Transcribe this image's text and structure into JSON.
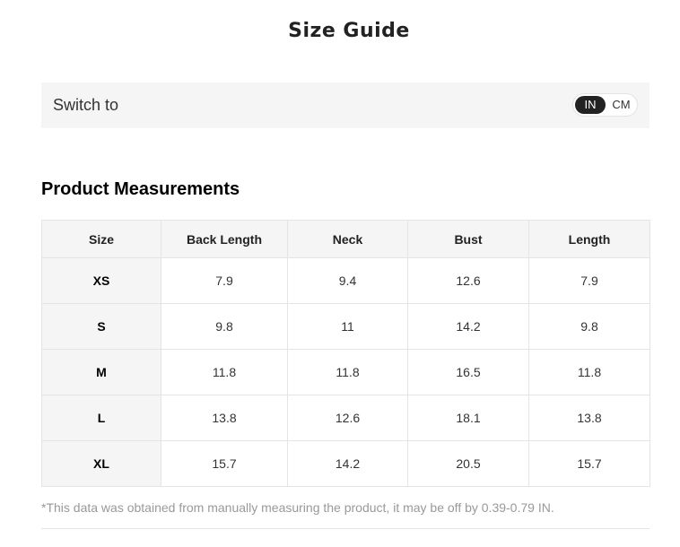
{
  "title": "Size Guide",
  "switch": {
    "label": "Switch to",
    "options": [
      "IN",
      "CM"
    ],
    "selected": "IN"
  },
  "section_title": "Product Measurements",
  "table": {
    "headers": [
      "Size",
      "Back Length",
      "Neck",
      "Bust",
      "Length"
    ],
    "rows": [
      [
        "XS",
        "7.9",
        "9.4",
        "12.6",
        "7.9"
      ],
      [
        "S",
        "9.8",
        "11",
        "14.2",
        "9.8"
      ],
      [
        "M",
        "11.8",
        "11.8",
        "16.5",
        "11.8"
      ],
      [
        "L",
        "13.8",
        "12.6",
        "18.1",
        "13.8"
      ],
      [
        "XL",
        "15.7",
        "14.2",
        "20.5",
        "15.7"
      ]
    ]
  },
  "footnote": "*This data was obtained from manually measuring the product, it may be off by 0.39-0.79 IN.",
  "colors": {
    "selected_toggle_bg": "#222222",
    "panel_bg": "#f5f5f5",
    "border": "#e4e4e4",
    "footnote_text": "#999999"
  }
}
